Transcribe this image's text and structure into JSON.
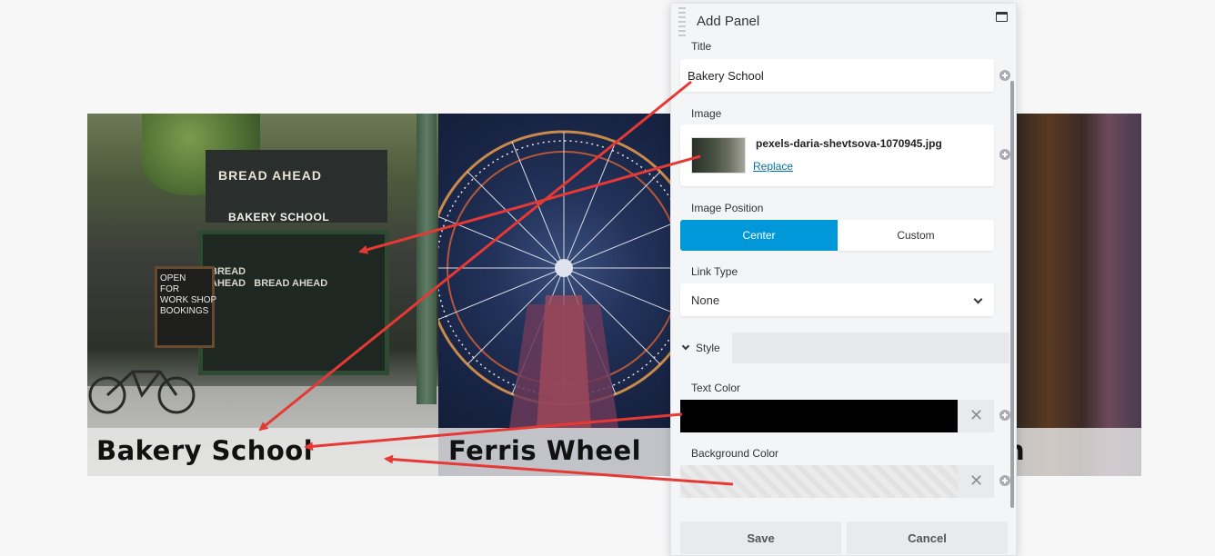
{
  "gallery": {
    "captions": [
      "Bakery School",
      "Ferris Wheel",
      "n"
    ],
    "bakery": {
      "awning_text": "BREAD AHEAD",
      "shop_sign": "BAKERY SCHOOL",
      "window_text": "BREAD\nAHEAD   BREAD AHEAD",
      "chalkboard_text": "OPEN\nFOR\nWORK SHOP\nBOOKINGS"
    }
  },
  "panel": {
    "title": "Add Panel",
    "fields": {
      "title_label": "Title",
      "title_value": "Bakery School",
      "image_label": "Image",
      "image_file": "pexels-daria-shevtsova-1070945.jpg",
      "replace_label": "Replace",
      "image_position_label": "Image Position",
      "image_position_options": [
        "Center",
        "Custom"
      ],
      "image_position_selected": "Center",
      "link_type_label": "Link Type",
      "link_type_value": "None"
    },
    "style_section": {
      "label": "Style",
      "text_color_label": "Text Color",
      "text_color_value": "#000000",
      "background_color_label": "Background Color",
      "clear_symbol": "✕"
    },
    "buttons": {
      "save": "Save",
      "cancel": "Cancel"
    }
  },
  "colors": {
    "accent": "#0098d8",
    "link": "#0073aa",
    "annotation": "#e53935"
  },
  "icons": [
    "drag-handle-icon",
    "maximize-icon",
    "plus-icon",
    "chevron-down-icon",
    "close-icon"
  ]
}
